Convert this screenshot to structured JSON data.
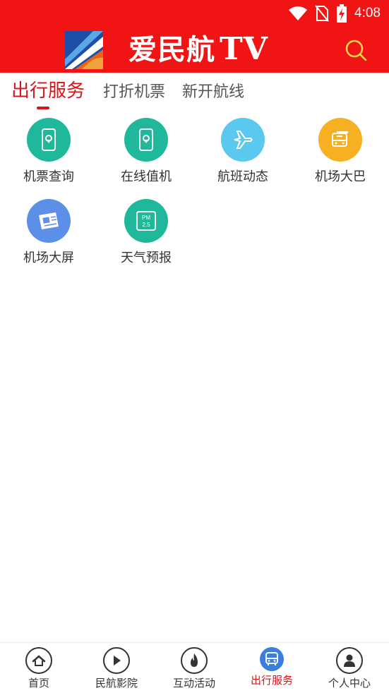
{
  "status": {
    "time": "4:08"
  },
  "header": {
    "brand": "爱民航",
    "brand_tv": "TV"
  },
  "tabs": [
    {
      "label": "出行服务",
      "active": true
    },
    {
      "label": "打折机票",
      "active": false
    },
    {
      "label": "新开航线",
      "active": false
    }
  ],
  "services": [
    {
      "label": "机票查询",
      "icon": "phone-location-icon",
      "color": "#1fb89a"
    },
    {
      "label": "在线值机",
      "icon": "phone-location-icon",
      "color": "#1fb89a"
    },
    {
      "label": "航班动态",
      "icon": "airplane-icon",
      "color": "#5bc8ef"
    },
    {
      "label": "机场大巴",
      "icon": "bus-icon",
      "color": "#f6b021"
    },
    {
      "label": "机场大屏",
      "icon": "news-icon",
      "color": "#5b8fe8"
    },
    {
      "label": "天气预报",
      "icon": "pm25-icon",
      "color": "#1fb89a",
      "icon_text_1": "PM",
      "icon_text_2": "2.5"
    }
  ],
  "bottom_nav": [
    {
      "label": "首页",
      "icon": "home-icon"
    },
    {
      "label": "民航影院",
      "icon": "play-icon"
    },
    {
      "label": "互动活动",
      "icon": "fire-icon"
    },
    {
      "label": "出行服务",
      "icon": "bus-icon",
      "active": true
    },
    {
      "label": "个人中心",
      "icon": "user-icon"
    }
  ],
  "colors": {
    "header_red": "#f01414",
    "accent_red": "#d8141b",
    "nav_active_blue": "#3a7ee0"
  }
}
